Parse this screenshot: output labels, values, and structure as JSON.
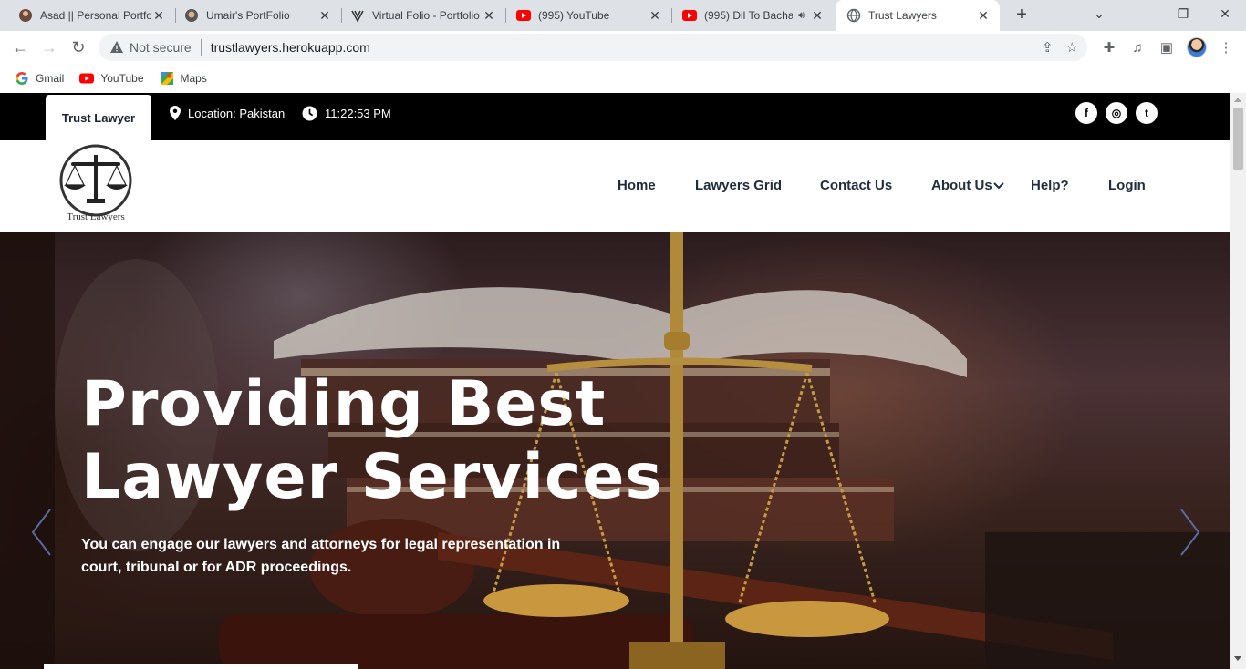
{
  "browser": {
    "tabs": [
      {
        "title": "Asad || Personal Portfo",
        "icon": "portrait-favicon"
      },
      {
        "title": "Umair's PortFolio",
        "icon": "portrait-favicon"
      },
      {
        "title": "Virtual Folio - Portfolio",
        "icon": "v-logo-favicon"
      },
      {
        "title": "(995) YouTube",
        "icon": "youtube-favicon"
      },
      {
        "title": "(995) Dil To Bacha",
        "icon": "youtube-favicon"
      },
      {
        "title": "Trust Lawyers",
        "icon": "globe-favicon"
      }
    ],
    "omnibox": {
      "security": "Not secure",
      "url": "trustlawyers.herokuapp.com"
    },
    "bookmarks": [
      {
        "label": "Gmail",
        "icon": "google-icon"
      },
      {
        "label": "YouTube",
        "icon": "youtube-icon"
      },
      {
        "label": "Maps",
        "icon": "maps-icon"
      }
    ]
  },
  "topbar": {
    "brand": "Trust Lawyer",
    "location": "Location: Pakistan",
    "time": "11:22:53 PM",
    "social": [
      "f",
      "◎",
      "t"
    ]
  },
  "navbar": {
    "logo_text": "Trust Lawyers",
    "links": [
      "Home",
      "Lawyers Grid",
      "Contact Us",
      "About Us",
      "Help?",
      "Login"
    ]
  },
  "hero": {
    "title_line1": "Providing Best",
    "title_line2": "Lawyer Services",
    "subtitle": "You can engage our lawyers and attorneys for legal representation in court, tribunal or for ADR proceedings."
  }
}
